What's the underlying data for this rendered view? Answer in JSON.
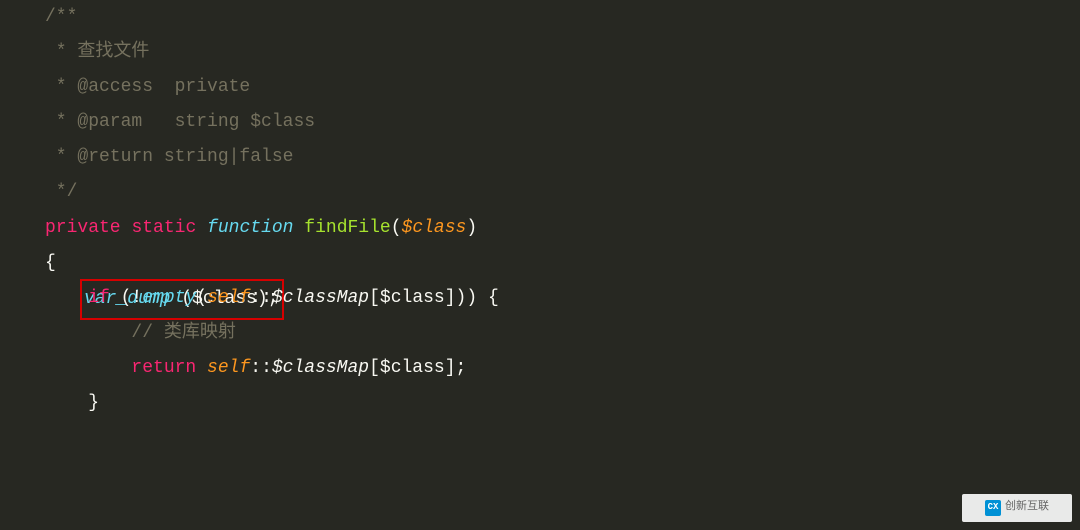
{
  "code": {
    "line1": "/**",
    "line2_pre": " * ",
    "line2_text": "查找文件",
    "line3": " * @access  private",
    "line4": " * @param   string $class",
    "line5": " * @return string|false",
    "line6": " */",
    "line7_private": "private",
    "line7_static": "static",
    "line7_function": "function",
    "line7_name": "findFile",
    "line7_param": "$class",
    "line8": "{",
    "line9_vardump": "var_dump",
    "line9_paren_open": " (",
    "line9_var": "$class",
    "line9_end": ");",
    "line10": "",
    "line11_if": "if",
    "line11_neg": " (!",
    "line11_empty": "empty",
    "line11_paren": "(",
    "line11_self": "self",
    "line11_colons": "::",
    "line11_classmap": "$classMap",
    "line11_bopen": "[",
    "line11_class": "$class",
    "line11_bclose": "])) {",
    "line12_comment": "// 类库映射",
    "line13_return": "return",
    "line13_sp": " ",
    "line13_self": "self",
    "line13_colons": "::",
    "line13_classmap": "$classMap",
    "line13_bopen": "[",
    "line13_class": "$class",
    "line13_bclose": "];",
    "line14": "}"
  },
  "watermark": {
    "icon": "CX",
    "text": "创新互联"
  }
}
